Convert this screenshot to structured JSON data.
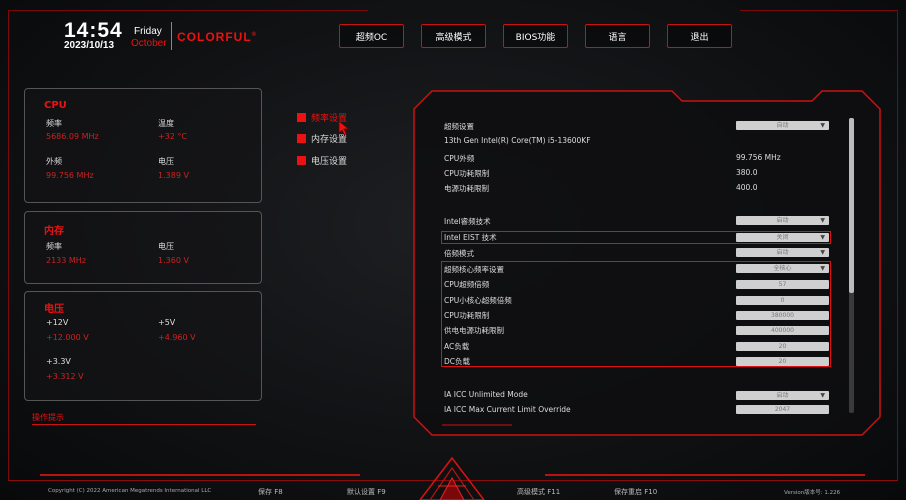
{
  "header": {
    "time": "14:54",
    "weekday": "Friday",
    "date": "2023/10/13",
    "month": "October",
    "brand": "COLORFUL"
  },
  "topnav": [
    {
      "label": "超频OC",
      "name": "nav-oc"
    },
    {
      "label": "高级模式",
      "name": "nav-advanced"
    },
    {
      "label": "BIOS功能",
      "name": "nav-bios"
    },
    {
      "label": "语言",
      "name": "nav-language"
    },
    {
      "label": "退出",
      "name": "nav-exit"
    }
  ],
  "cpu": {
    "title": "CPU",
    "freq_label": "频率",
    "freq_value": "5686.09 MHz",
    "temp_label": "温度",
    "temp_value": "+32 °C",
    "bclk_label": "外频",
    "bclk_value": "99.756 MHz",
    "volt_label": "电压",
    "volt_value": "1.389 V"
  },
  "memory": {
    "title": "内存",
    "freq_label": "频率",
    "freq_value": "2133 MHz",
    "volt_label": "电压",
    "volt_value": "1.360 V"
  },
  "voltage": {
    "title": "电压",
    "v12_label": "+12V",
    "v12_value": "+12.000 V",
    "v5_label": "+5V",
    "v5_value": "+4.960 V",
    "v33_label": "+3.3V",
    "v33_value": "+3.312 V"
  },
  "hint": {
    "title": "操作提示"
  },
  "menu": [
    {
      "label": "频率设置",
      "active": true
    },
    {
      "label": "内存设置",
      "active": false
    },
    {
      "label": "电压设置",
      "active": false
    }
  ],
  "settings": {
    "oc_setting": {
      "label": "超频设置",
      "value": "自动"
    },
    "cpu_model": "13th Gen Intel(R) Core(TM) i5-13600KF",
    "cpu_bclk": {
      "label": "CPU外频",
      "value": "99.756 MHz"
    },
    "cpu_power_limit": {
      "label": "CPU功耗限制",
      "value": "380.0"
    },
    "power_limit": {
      "label": "电源功耗限制",
      "value": "400.0"
    },
    "turbo": {
      "label": "Intel睿频技术",
      "value": "启动"
    },
    "eist": {
      "label": "Intel EIST 技术",
      "value": "关闭"
    },
    "ratio_mode": {
      "label": "倍频模式",
      "value": "启动"
    },
    "core_ratio": {
      "label": "超频核心频率设置",
      "value": "全核心"
    },
    "p_ratio": {
      "label": "CPU超频倍频",
      "value": "57"
    },
    "e_ratio": {
      "label": "CPU小核心超频倍频",
      "value": "0"
    },
    "cpu_pl": {
      "label": "CPU功耗限制",
      "value": "380000"
    },
    "psu_pl": {
      "label": "供电电源功耗限制",
      "value": "400000"
    },
    "ac_load": {
      "label": "AC负载",
      "value": "20"
    },
    "dc_load": {
      "label": "DC负载",
      "value": "20"
    },
    "ia_icc": {
      "label": "IA ICC Unlimited Mode",
      "value": "启动"
    },
    "ia_icc_override": {
      "label": "IA ICC Max Current Limit Override",
      "value": "2047"
    }
  },
  "footer": {
    "copyright": "Copyright (C) 2022 American Megatrends International LLC",
    "save": "保存 F8",
    "defaults": "默认设置 F9",
    "advanced": "高级模式 F11",
    "save_exit": "保存重启 F10",
    "version": "Version版本号: 1.226"
  },
  "colors": {
    "accent": "#e01010",
    "background": "#101113"
  }
}
